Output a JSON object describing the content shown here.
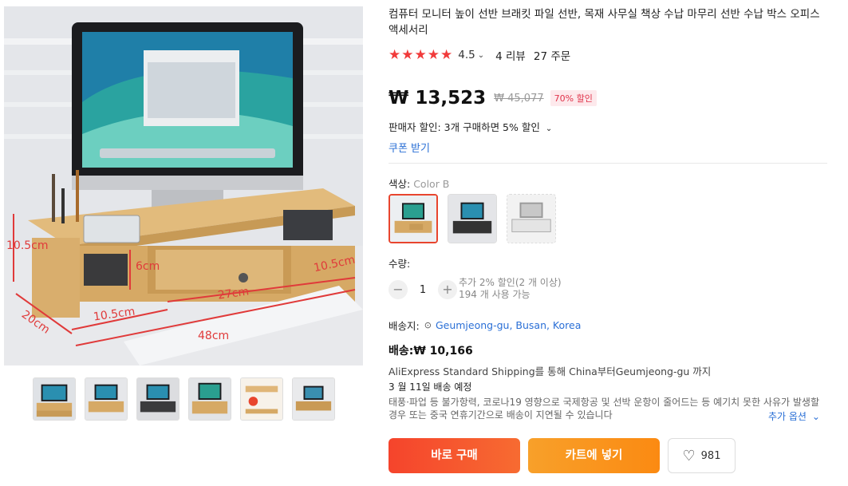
{
  "product": {
    "title": "컴퓨터 모니터 높이 선반 브래킷 파일 선반, 목재 사무실 책상 수납 마무리 선반 수납 박스 오피스 액세서리",
    "rating": "4.5",
    "reviews": "4 리뷰",
    "orders": "27 주문"
  },
  "main_image": {
    "dimension_labels": [
      "10.5cm",
      "6cm",
      "10.5cm",
      "27cm",
      "10.5cm",
      "20cm",
      "48cm"
    ]
  },
  "price": {
    "current": "₩ 13,523",
    "original": "₩ 45,077",
    "discount": "70% 할인"
  },
  "seller_discount": "판매자 할인: 3개 구매하면 5% 할인",
  "coupon": "쿠폰 받기",
  "color": {
    "label": "색상:",
    "selected": "Color B"
  },
  "quantity": {
    "label": "수량:",
    "value": "1",
    "minus": "−",
    "plus": "+",
    "note_line1": "추가 2% 할인(2 개 이상)",
    "note_line2": "194 개 사용 가능"
  },
  "shipping": {
    "to_label": "배송지:",
    "location": "Geumjeong-gu, Busan, Korea",
    "fee": "배송:₩ 10,166",
    "method": "AliExpress Standard Shipping를 통해 China부터Geumjeong-gu 까지",
    "date": "3 월 11일 배송 예정",
    "notice": "태풍·파업 등 불가항력, 코로나19 영향으로 국제항공 및 선박 운항이 줄어드는 등 예기치 못한 사유가 발생할 경우 또는 중국 연휴기간으로 배송이 지연될 수 있습니다",
    "more_options": "추가 옵션"
  },
  "actions": {
    "buy_now": "바로 구매",
    "add_to_cart": "카트에 넣기",
    "wishlist_count": "981"
  },
  "colors": {
    "star": "#f13b3b",
    "buy": "#f5442c",
    "cart": "#fb8a12",
    "link": "#2a6fd6",
    "discount": "#e0334a"
  }
}
